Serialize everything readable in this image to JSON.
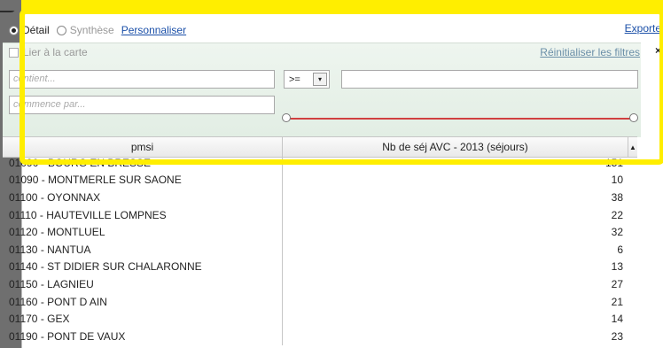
{
  "view": {
    "detail_label": "Détail",
    "synthesis_label": "Synthèse",
    "customize_link": "Personnaliser",
    "export_link": "Exporte"
  },
  "filters": {
    "link_to_map_label": "Lier à la carte",
    "reset_link": "Réinitialiser les filtres",
    "close_symbol": "×",
    "contains_placeholder": "contient...",
    "starts_with_placeholder": "commence par...",
    "operator_value": ">=",
    "operator_arrow": "▾"
  },
  "table": {
    "col_headers": [
      "pmsi",
      "Nb de séj AVC - 2013 (séjours)"
    ],
    "sort_icon": "▲",
    "rows": [
      [
        "01090 - BOURG EN BRESSE",
        "151"
      ],
      [
        "01090 - MONTMERLE SUR SAONE",
        "10"
      ],
      [
        "01100 - OYONNAX",
        "38"
      ],
      [
        "01110 - HAUTEVILLE LOMPNES",
        "22"
      ],
      [
        "01120 - MONTLUEL",
        "32"
      ],
      [
        "01130 - NANTUA",
        "6"
      ],
      [
        "01140 - ST DIDIER SUR CHALARONNE",
        "13"
      ],
      [
        "01150 - LAGNIEU",
        "27"
      ],
      [
        "01160 - PONT D AIN",
        "21"
      ],
      [
        "01170 - GEX",
        "14"
      ],
      [
        "01190 - PONT DE VAUX",
        "23"
      ]
    ]
  }
}
